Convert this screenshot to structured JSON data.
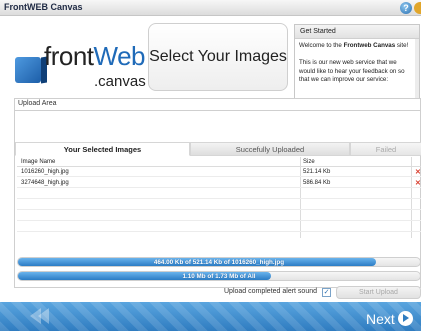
{
  "app": {
    "title": "FrontWEB Canvas"
  },
  "icons": {
    "help": "help-icon"
  },
  "logo": {
    "front": "front",
    "web": "Web",
    "sub": ".canvas"
  },
  "select_images": {
    "label": "Select Your Images"
  },
  "get_started": {
    "title": "Get Started",
    "text_before": "Welcome to the ",
    "text_bold": "Frontweb Canvas",
    "text_after": " site!",
    "text_2": "This is our new web service that we would like to hear your feedback on so that we can improve our service:"
  },
  "upload_area": {
    "label": "Upload Area",
    "tabs": [
      {
        "label": "Your Selected Images",
        "state": "active"
      },
      {
        "label": "Succefully Uploaded",
        "state": "inactive"
      },
      {
        "label": "Failed",
        "state": "disabled"
      }
    ],
    "columns": {
      "name": "Image Name",
      "size": "Size"
    },
    "rows": [
      {
        "name": "1016260_high.jpg",
        "size": "521.14 Kb"
      },
      {
        "name": "3274648_high.jpg",
        "size": "586.84 Kb"
      }
    ]
  },
  "progress": {
    "file": {
      "text": "464.00 Kb of 521.14 Kb of 1016260_high.jpg",
      "percent": 89
    },
    "total": {
      "text": "1.10 Mb of 1.73 Mb of All",
      "percent": 63
    }
  },
  "options": {
    "alert_label": "Upload completed alert sound",
    "alert_checked": "✓"
  },
  "start_upload": {
    "label": "Start Upload"
  },
  "footer": {
    "next": "Next"
  },
  "colors": {
    "accent": "#2f7cc0",
    "progress": "#2b7cc5",
    "delete": "#d83a2a"
  }
}
